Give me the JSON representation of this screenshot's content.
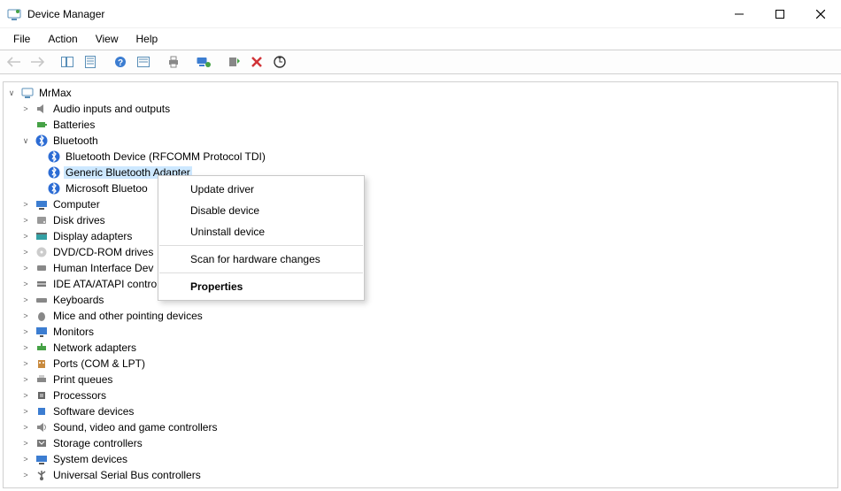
{
  "window": {
    "title": "Device Manager"
  },
  "menubar": [
    "File",
    "Action",
    "View",
    "Help"
  ],
  "toolbar_tip": {
    "back": "Back",
    "forward": "Forward",
    "show_hide": "Show/Hide Console Tree",
    "properties": "Properties",
    "help": "Help",
    "action_list": "Action List",
    "print": "Print",
    "remote": "Connect to another computer",
    "update": "Update driver",
    "uninstall": "Uninstall device",
    "scan": "Scan for hardware changes"
  },
  "root": "MrMax",
  "categories": [
    {
      "expander": ">",
      "icon": "audio",
      "label": "Audio inputs and outputs"
    },
    {
      "expander": "",
      "icon": "battery",
      "label": "Batteries"
    },
    {
      "expander": "v",
      "icon": "bt",
      "label": "Bluetooth",
      "children": [
        {
          "icon": "bt",
          "label": "Bluetooth Device (RFCOMM Protocol TDI)"
        },
        {
          "icon": "bt",
          "label": "Generic Bluetooth Adapter",
          "selected": true
        },
        {
          "icon": "bt",
          "label": "Microsoft Bluetoo"
        }
      ]
    },
    {
      "expander": ">",
      "icon": "computer",
      "label": "Computer"
    },
    {
      "expander": ">",
      "icon": "disk",
      "label": "Disk drives"
    },
    {
      "expander": ">",
      "icon": "display",
      "label": "Display adapters"
    },
    {
      "expander": ">",
      "icon": "dvd",
      "label": "DVD/CD-ROM drives"
    },
    {
      "expander": ">",
      "icon": "hid",
      "label": "Human Interface Dev"
    },
    {
      "expander": ">",
      "icon": "ide",
      "label": "IDE ATA/ATAPI contro"
    },
    {
      "expander": ">",
      "icon": "keyboard",
      "label": "Keyboards"
    },
    {
      "expander": ">",
      "icon": "mouse",
      "label": "Mice and other pointing devices"
    },
    {
      "expander": ">",
      "icon": "monitor",
      "label": "Monitors"
    },
    {
      "expander": ">",
      "icon": "net",
      "label": "Network adapters"
    },
    {
      "expander": ">",
      "icon": "port",
      "label": "Ports (COM & LPT)"
    },
    {
      "expander": ">",
      "icon": "printq",
      "label": "Print queues"
    },
    {
      "expander": ">",
      "icon": "cpu",
      "label": "Processors"
    },
    {
      "expander": ">",
      "icon": "soft",
      "label": "Software devices"
    },
    {
      "expander": ">",
      "icon": "sound",
      "label": "Sound, video and game controllers"
    },
    {
      "expander": ">",
      "icon": "storage",
      "label": "Storage controllers"
    },
    {
      "expander": ">",
      "icon": "system",
      "label": "System devices"
    },
    {
      "expander": ">",
      "icon": "usb",
      "label": "Universal Serial Bus controllers"
    }
  ],
  "context_menu": {
    "update": "Update driver",
    "disable": "Disable device",
    "uninstall": "Uninstall device",
    "scan": "Scan for hardware changes",
    "properties": "Properties"
  }
}
